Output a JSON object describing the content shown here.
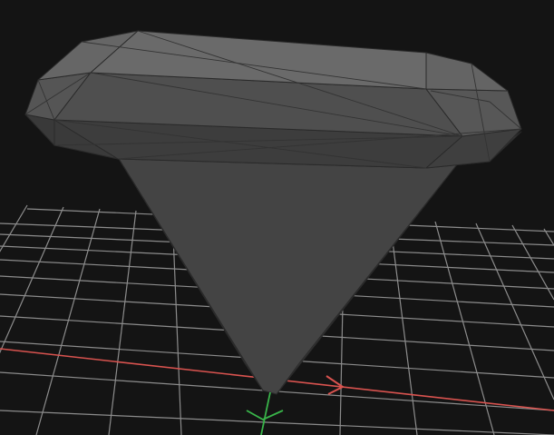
{
  "viewport": {
    "kind": "3d-model-viewport",
    "background_color": "#141414",
    "grid_color": "#9a9a9a",
    "x_axis_color": "#d9534f",
    "y_axis_color": "#39b54a",
    "model_shading": [
      "#3a3a3a",
      "#444444",
      "#4f4f4f",
      "#5a5a5a",
      "#666666",
      "#707070"
    ],
    "model_edge_color": "#2a2a2a"
  },
  "icons": {
    "x_axis_arrow": "x-axis-arrow-icon",
    "y_axis_gizmo": "y-axis-gizmo-icon"
  }
}
